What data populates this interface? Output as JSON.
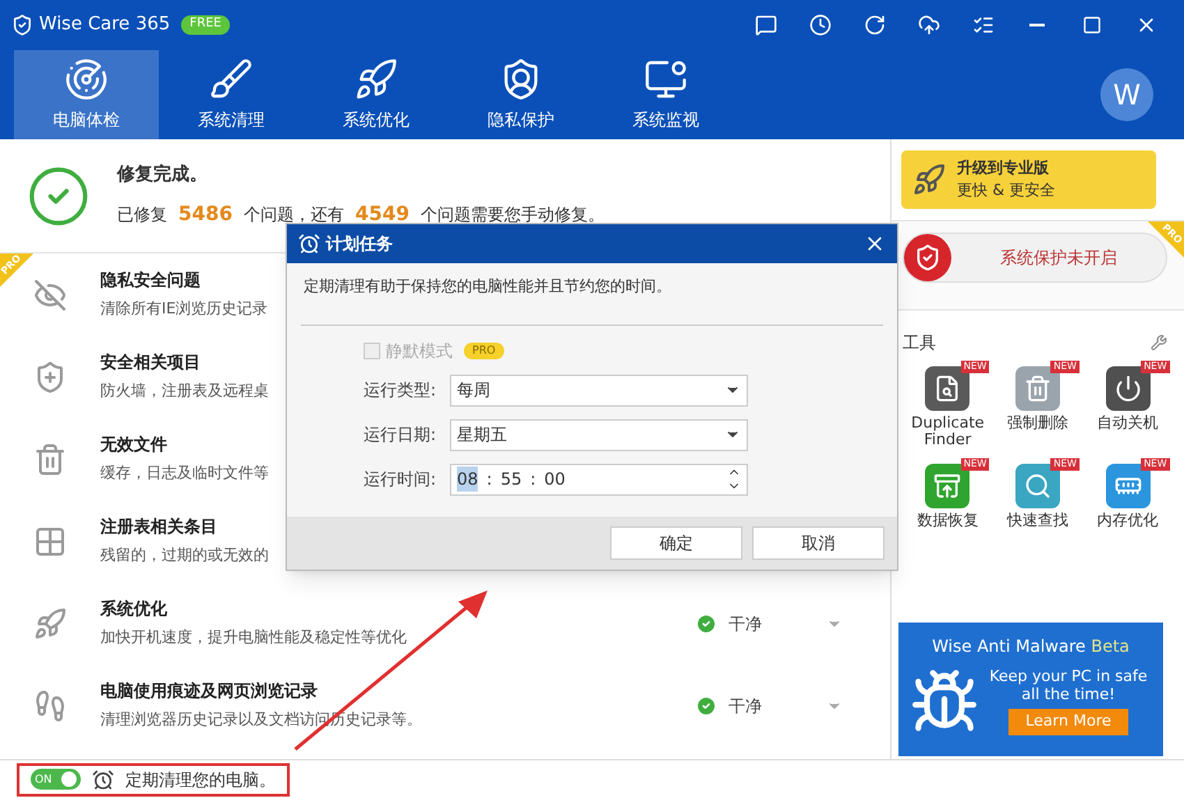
{
  "window": {
    "title": "Wise Care 365",
    "edition": "FREE"
  },
  "toolbar": [
    {
      "kind": "feedback"
    },
    {
      "kind": "history"
    },
    {
      "kind": "refresh"
    },
    {
      "kind": "cloud"
    },
    {
      "kind": "menu"
    }
  ],
  "tabs": [
    {
      "label": "电脑体检",
      "kind": "checkup",
      "selected": true
    },
    {
      "label": "系统清理",
      "kind": "clean",
      "selected": false
    },
    {
      "label": "系统优化",
      "kind": "optimize",
      "selected": false
    },
    {
      "label": "隐私保护",
      "kind": "privacy",
      "selected": false
    },
    {
      "label": "系统监视",
      "kind": "monitor",
      "selected": false
    }
  ],
  "avatar": {
    "letter": "W"
  },
  "summary": {
    "title": "修复完成。",
    "parts": [
      {
        "text": "已修复",
        "highlight": false
      },
      {
        "text": "5486",
        "highlight": true
      },
      {
        "text": "个问题，还有",
        "highlight": false
      },
      {
        "text": "4549",
        "highlight": true
      },
      {
        "text": "个问题需要您手动修复。",
        "highlight": false
      }
    ]
  },
  "items": [
    {
      "kind": "privacy",
      "title": "隐私安全问题",
      "description": "清除所有IE浏览历史记录",
      "ribbon": "PRO"
    },
    {
      "kind": "security",
      "title": "安全相关项目",
      "description": "防火墙，注册表及远程桌"
    },
    {
      "kind": "junk",
      "title": "无效文件",
      "description": "缓存，日志及临时文件等"
    },
    {
      "kind": "registry",
      "title": "注册表相关条目",
      "description": "残留的，过期的或无效的"
    },
    {
      "kind": "optimize",
      "title": "系统优化",
      "description": "加快开机速度，提升电脑性能及稳定性等优化",
      "status": "干净"
    },
    {
      "kind": "traces",
      "title": "电脑使用痕迹及网页浏览记录",
      "description": "清理浏览器历史记录以及文档访问历史记录等。",
      "status": "干净"
    }
  ],
  "status_bar": {
    "toggle": {
      "label": "ON",
      "on": true
    },
    "text": "定期清理您的电脑。"
  },
  "sidebar": {
    "upgrade": {
      "title": "升级到专业版",
      "subtitle": "更快 & 更安全"
    },
    "protection": {
      "label": "系统保护未开启",
      "ribbon": "PRO"
    },
    "tools": {
      "title": "工具",
      "items": [
        {
          "kind": "duplicate",
          "label": "Duplicate Finder",
          "badge": "NEW"
        },
        {
          "kind": "shred",
          "label": "强制删除",
          "badge": "NEW"
        },
        {
          "kind": "shutdown",
          "label": "自动关机",
          "badge": "NEW"
        },
        {
          "kind": "recovery",
          "label": "数据恢复",
          "badge": "NEW"
        },
        {
          "kind": "search",
          "label": "快速查找",
          "badge": "NEW"
        },
        {
          "kind": "memory",
          "label": "内存优化",
          "badge": "NEW"
        }
      ]
    },
    "ad": {
      "title": "Wise Anti Malware",
      "tag": "Beta",
      "text": "Keep your PC in safe all the time!",
      "button": "Learn More"
    }
  },
  "dialog": {
    "title": "计划任务",
    "description": "定期清理有助于保持您的电脑性能并且节约您的时间。",
    "silent_mode": {
      "label": "静默模式",
      "badge": "PRO",
      "checked": false,
      "disabled": true
    },
    "fields": [
      {
        "kind": "select",
        "label": "运行类型:",
        "value": "每周"
      },
      {
        "kind": "select",
        "label": "运行日期:",
        "value": "星期五"
      },
      {
        "kind": "time",
        "label": "运行时间:",
        "separator": ":",
        "parts": [
          {
            "text": "08",
            "selected": true
          },
          {
            "text": "55",
            "selected": false
          },
          {
            "text": "00",
            "selected": false
          }
        ]
      }
    ],
    "buttons": [
      "确定",
      "取消"
    ]
  }
}
